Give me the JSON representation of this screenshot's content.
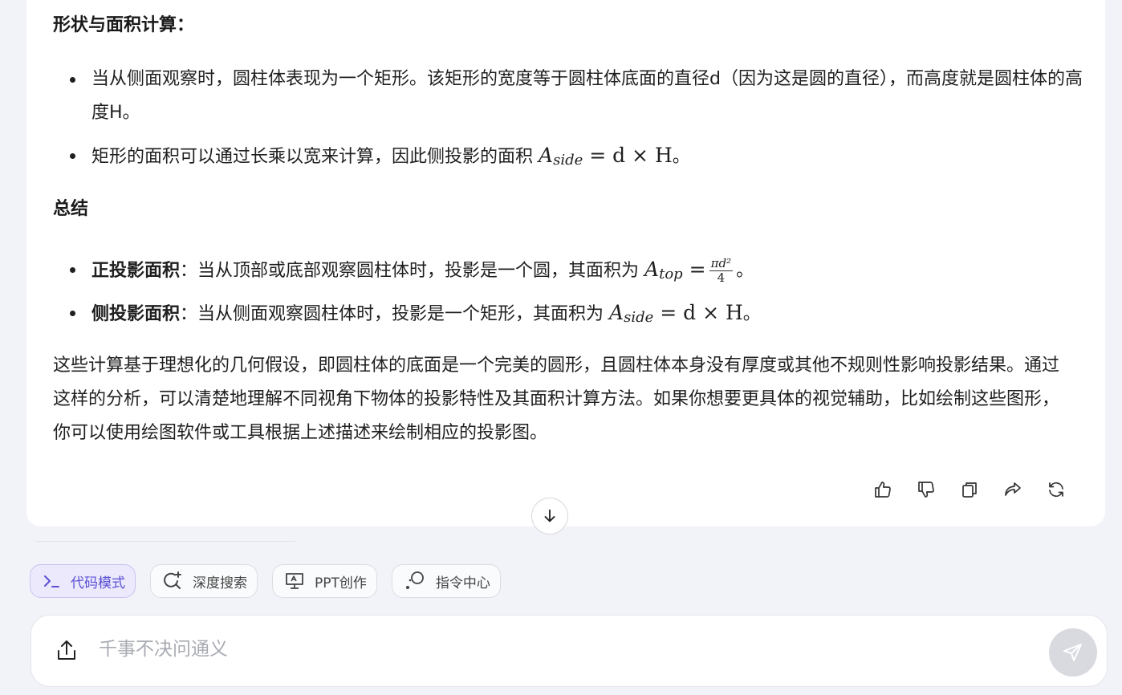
{
  "message": {
    "shape_heading": "形状与面积计算：",
    "shape_items": [
      "当从侧面观察时，圆柱体表现为一个矩形。该矩形的宽度等于圆柱体底面的直径d（因为这是圆的直径），而高度就是圆柱体的高度H。",
      "矩形的面积可以通过长乘以宽来计算，因此侧投影的面积"
    ],
    "summary_heading": "总结",
    "summary_items": [
      {
        "bold": "正投影面积",
        "text": "：当从顶部或底部观察圆柱体时，投影是一个圆，其面积为"
      },
      {
        "bold": "侧投影面积",
        "text": "：当从侧面观察圆柱体时，投影是一个矩形，其面积为"
      }
    ],
    "formula_side": {
      "A": "A",
      "sub": "side",
      "rest": "= d × H"
    },
    "formula_top": {
      "A": "A",
      "sub": "top",
      "eq": "=",
      "num": "πd²",
      "den": "4"
    },
    "period": "。",
    "conclusion": "这些计算基于理想化的几何假设，即圆柱体的底面是一个完美的圆形，且圆柱体本身没有厚度或其他不规则性影响投影结果。通过这样的分析，可以清楚地理解不同视角下物体的投影特性及其面积计算方法。如果你想要更具体的视觉辅助，比如绘制这些图形，你可以使用绘图软件或工具根据上述描述来绘制相应的投影图。"
  },
  "actions": [
    "thumbs-up-icon",
    "thumbs-down-icon",
    "copy-icon",
    "share-icon",
    "regenerate-icon"
  ],
  "chips": [
    {
      "label": "代码模式",
      "icon": "terminal-icon",
      "active": true
    },
    {
      "label": "深度搜索",
      "icon": "deep-search-icon",
      "active": false
    },
    {
      "label": "PPT创作",
      "icon": "presentation-icon",
      "active": false
    },
    {
      "label": "指令中心",
      "icon": "command-center-icon",
      "active": false
    }
  ],
  "input": {
    "placeholder": "千事不决问通义"
  },
  "colors": {
    "accent": "#5a4fd6",
    "chip_active_bg": "#ebe9fb",
    "send_bg": "#d9dae0"
  }
}
